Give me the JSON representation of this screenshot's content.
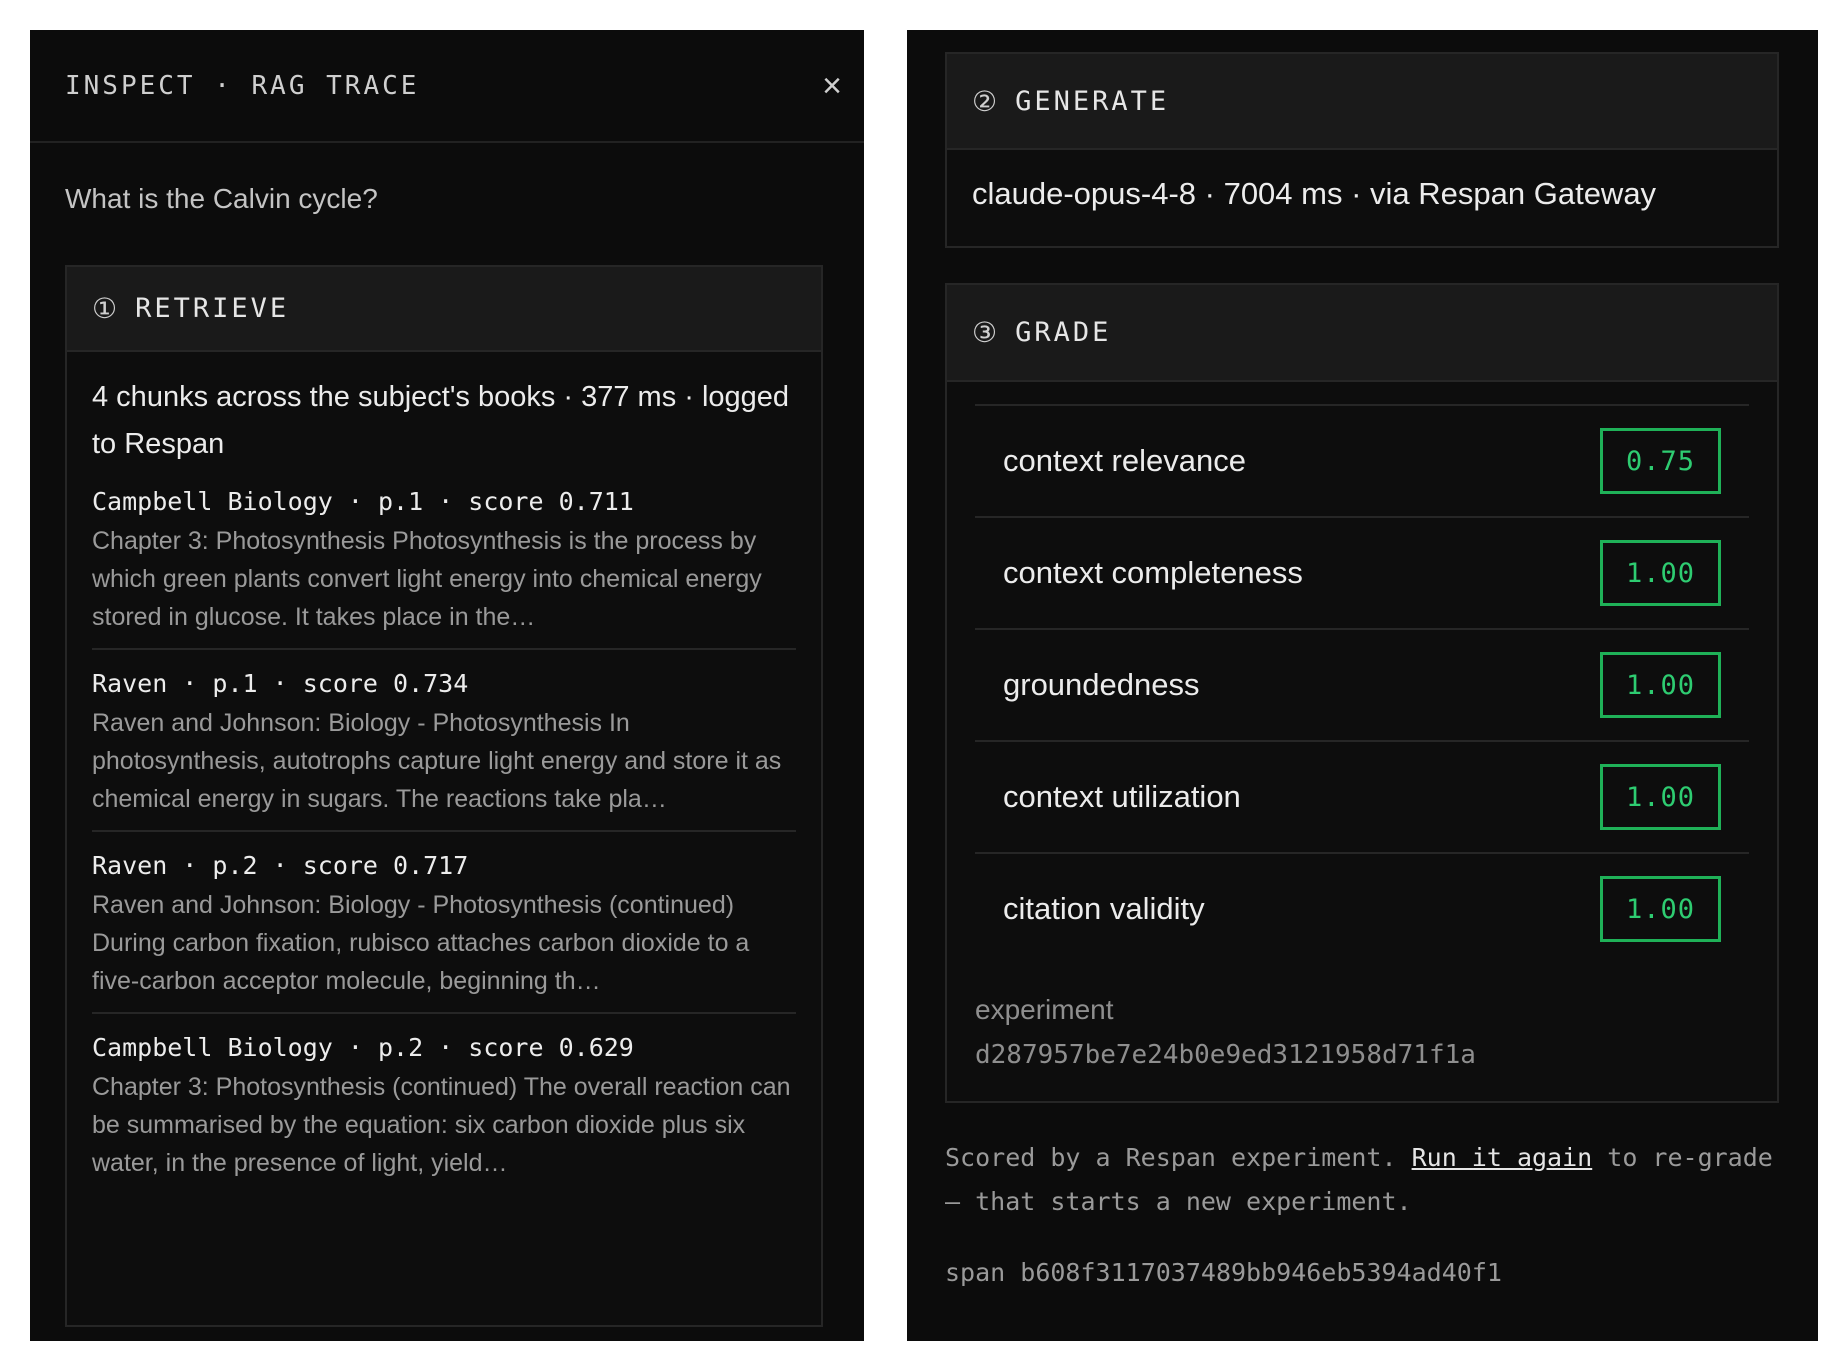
{
  "header": {
    "title": "INSPECT · RAG TRACE",
    "close_icon": "close-icon",
    "close_glyph": "×"
  },
  "question": "What is the Calvin cycle?",
  "retrieve": {
    "number": "①",
    "label": "RETRIEVE",
    "summary": "4 chunks across the subject's books · 377 ms · logged to Respan",
    "chunks": [
      {
        "meta": "Campbell Biology · p.1 · score 0.711",
        "text": "Chapter 3: Photosynthesis Photosynthesis is the process by which green plants convert light energy into chemical energy stored in glucose. It takes place in the…"
      },
      {
        "meta": "Raven · p.1 · score 0.734",
        "text": "Raven and Johnson: Biology - Photosynthesis In photosynthesis, autotrophs capture light energy and store it as chemical energy in sugars. The reactions take pla…"
      },
      {
        "meta": "Raven · p.2 · score 0.717",
        "text": "Raven and Johnson: Biology - Photosynthesis (continued) During carbon fixation, rubisco attaches carbon dioxide to a five-carbon acceptor molecule, beginning th…"
      },
      {
        "meta": "Campbell Biology · p.2 · score 0.629",
        "text": "Chapter 3: Photosynthesis (continued) The overall reaction can be summarised by the equation: six carbon dioxide plus six water, in the presence of light, yield…"
      }
    ]
  },
  "generate": {
    "number": "②",
    "label": "GENERATE",
    "detail": "claude-opus-4-8 · 7004 ms · via Respan Gateway"
  },
  "grade": {
    "number": "③",
    "label": "GRADE",
    "metrics": [
      {
        "name": "context relevance",
        "score": "0.75"
      },
      {
        "name": "context completeness",
        "score": "1.00"
      },
      {
        "name": "groundedness",
        "score": "1.00"
      },
      {
        "name": "context utilization",
        "score": "1.00"
      },
      {
        "name": "citation validity",
        "score": "1.00"
      }
    ],
    "experiment_label": "experiment",
    "experiment_id": "d287957be7e24b0e9ed3121958d71f1a",
    "score_color": "#2ecc71"
  },
  "footer": {
    "note_before": "Scored by a Respan experiment. ",
    "link": "Run it again",
    "note_after": " to re-grade — that starts a new experiment.",
    "span_label": "span",
    "span_id": "b608f3117037489bb946eb5394ad40f1"
  }
}
